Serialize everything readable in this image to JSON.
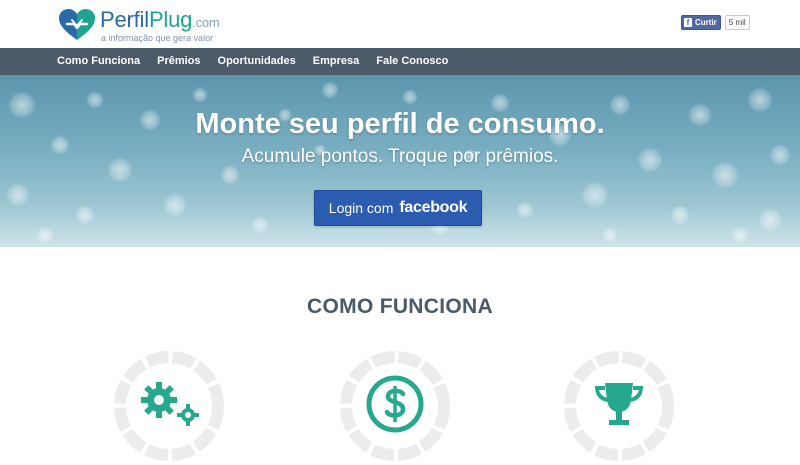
{
  "header": {
    "logo_name_part1": "Perfil",
    "logo_name_part2": "Plug",
    "logo_domain": ".com",
    "tagline": "a informação que gera valor",
    "like_button": "Curtir",
    "like_count": "5 mil"
  },
  "nav": {
    "items": [
      "Como Funciona",
      "Prêmios",
      "Oportunidades",
      "Empresa",
      "Fale Conosco"
    ]
  },
  "hero": {
    "title": "Monte seu perfil de consumo.",
    "subtitle": "Acumule pontos. Troque por prêmios.",
    "login_label": "Login com",
    "login_brand": "facebook"
  },
  "how_it_works": {
    "title": "COMO FUNCIONA",
    "steps": [
      {
        "icon": "gears-icon"
      },
      {
        "icon": "dollar-coin-icon"
      },
      {
        "icon": "trophy-icon"
      }
    ]
  },
  "colors": {
    "brand_blue": "#2a6aa6",
    "brand_teal": "#1ea58f",
    "nav_bg": "#4b5a68",
    "facebook_button": "#2c5cb0",
    "icon_teal": "#26a88e",
    "ring_gray": "#ececec"
  }
}
